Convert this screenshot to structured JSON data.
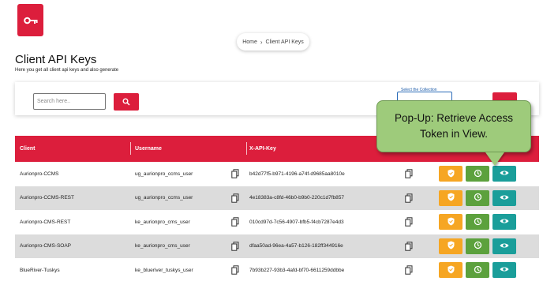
{
  "app": {
    "breadcrumb": {
      "home": "Home",
      "current": "Client API Keys"
    },
    "title": "Client API Keys",
    "subtitle": "Here you get all client api keys and also generate"
  },
  "search": {
    "placeholder": "Search here..",
    "collection_label": "Select the Collection"
  },
  "table": {
    "headers": {
      "client": "Client",
      "username": "Username",
      "api_key": "X-API-Key"
    },
    "rows": [
      {
        "client": "Aurionpro-CCMS",
        "username": "ug_aurionpro_ccms_user",
        "api_key": "b42d77f5-b971-4196-a74f-d9685aa8010e"
      },
      {
        "client": "Aurionpro-CCMS-REST",
        "username": "ug_aurionpro_ccms_user",
        "api_key": "4e18383a-c8fd-46b0-b9b0-220c1d7fb857"
      },
      {
        "client": "Aurionpro-CMS-REST",
        "username": "ke_aurionpro_cms_user",
        "api_key": "010cd97d-7c56-4907-bfb5-f4cb7287e4d3"
      },
      {
        "client": "Aurionpro-CMS-SOAP",
        "username": "ke_aurionpro_cms_user",
        "api_key": "dfaa50ad-96ea-4a57-b126-182ff344916e"
      },
      {
        "client": "BlueRiver-Tuskys",
        "username": "ke_blueriver_tuskys_user",
        "api_key": "7b93b227-93b3-4afd-bf70-6611259ddbbe"
      }
    ]
  },
  "popup": {
    "text": "Pop-Up: Retrieve Access Token in View."
  },
  "icons": {
    "logo": "key-icon",
    "search": "search-icon",
    "copy": "copy-icon",
    "shield": "shield-icon",
    "history": "history-icon",
    "view": "eye-icon"
  },
  "colors": {
    "brand": "#dc1e3c",
    "shield_button": "#f6a623",
    "history_button": "#5ca13d",
    "view_button": "#1a9e9a",
    "callout": "#9ecb7b"
  }
}
